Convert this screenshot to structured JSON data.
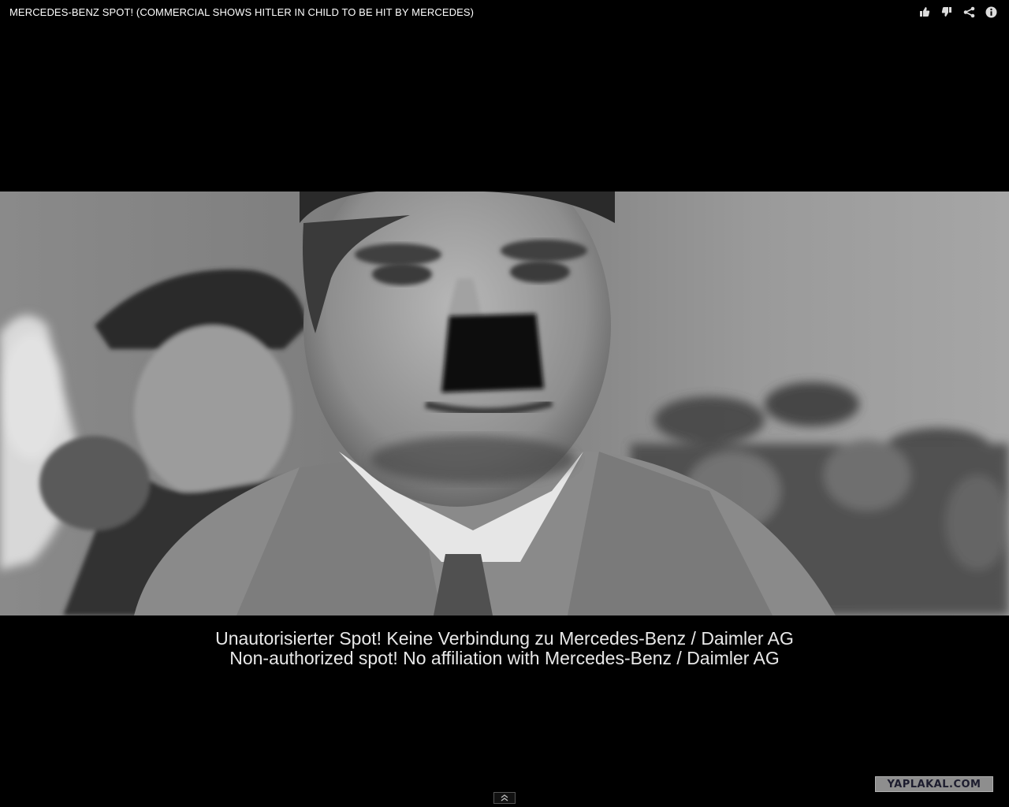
{
  "video": {
    "title": "MERCEDES-BENZ SPOT! (COMMERCIAL SHOWS HITLER IN CHILD TO BE HIT BY MERCEDES)"
  },
  "actions": [
    {
      "name": "like",
      "icon": "thumbs-up-icon"
    },
    {
      "name": "dislike",
      "icon": "thumbs-down-icon"
    },
    {
      "name": "share",
      "icon": "share-icon"
    },
    {
      "name": "info",
      "icon": "info-icon"
    }
  ],
  "caption": {
    "line1": "Unautorisierter Spot! Keine Verbindung zu Mercedes-Benz / Daimler AG",
    "line2": "Non-authorized spot! No affiliation with Mercedes-Benz / Daimler AG"
  },
  "controls": {
    "expand_icon": "double-chevron-up-icon"
  },
  "watermark": {
    "text": "YAPLAKAL.COM"
  },
  "colors": {
    "background": "#000000",
    "title_text": "#ffffff",
    "caption_text": "#e8e8e8",
    "watermark_bg": "#8e8e8e",
    "watermark_text": "#1c1c2e"
  }
}
